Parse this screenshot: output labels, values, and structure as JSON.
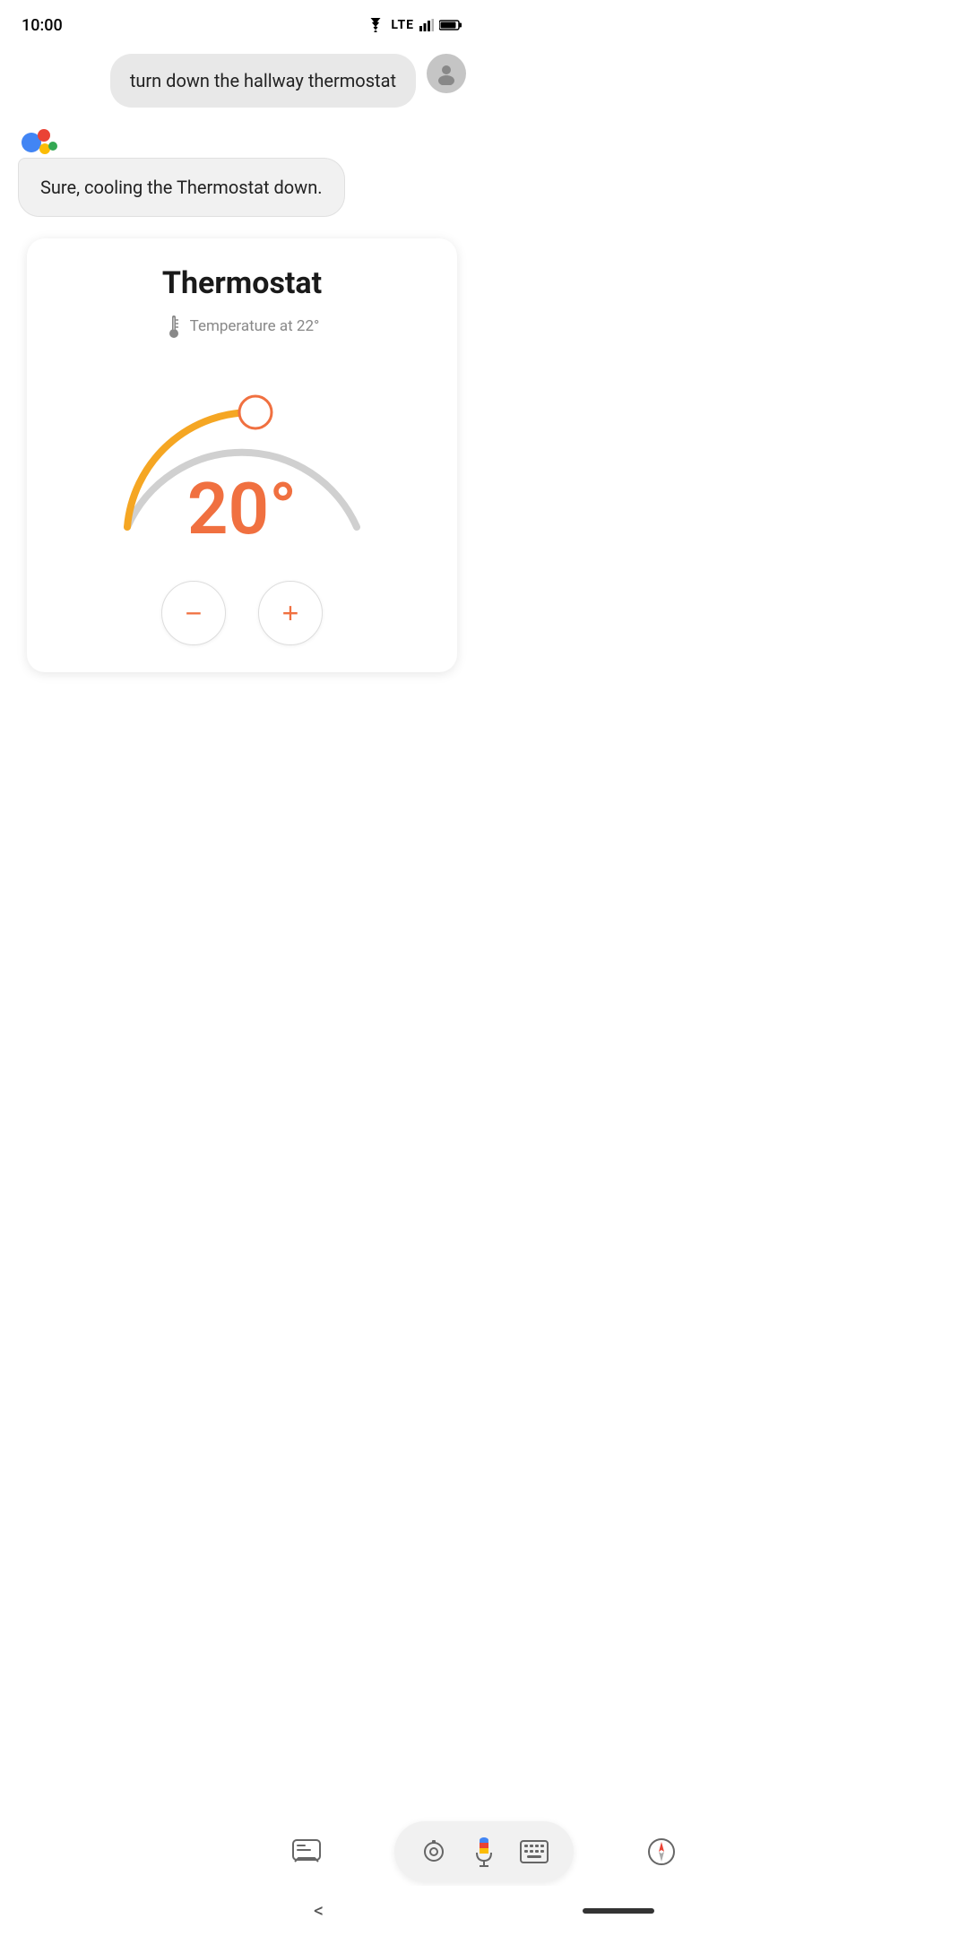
{
  "statusBar": {
    "time": "10:00"
  },
  "userMessage": {
    "text": "turn down the hallway thermostat",
    "avatarLabel": "user-avatar"
  },
  "assistantMessage": {
    "text": "Sure, cooling the Thermostat down."
  },
  "thermostatCard": {
    "title": "Thermostat",
    "temperatureLabel": "Temperature at 22°",
    "currentTemp": "20°",
    "arcActiveColor": "#F5A623",
    "arcInactiveColor": "#d0d0d0",
    "handleColor": "#f07040",
    "decrementLabel": "−",
    "incrementLabel": "+"
  },
  "bottomBar": {
    "assistantInputIcon": "assistant-icon",
    "lensIcon": "lens-icon",
    "micIcon": "mic-icon",
    "keyboardIcon": "keyboard-icon",
    "compassIcon": "compass-icon"
  },
  "navBar": {
    "backLabel": "<"
  },
  "colors": {
    "orange": "#F5A623",
    "salmon": "#f07040",
    "gray": "#d0d0d0"
  }
}
